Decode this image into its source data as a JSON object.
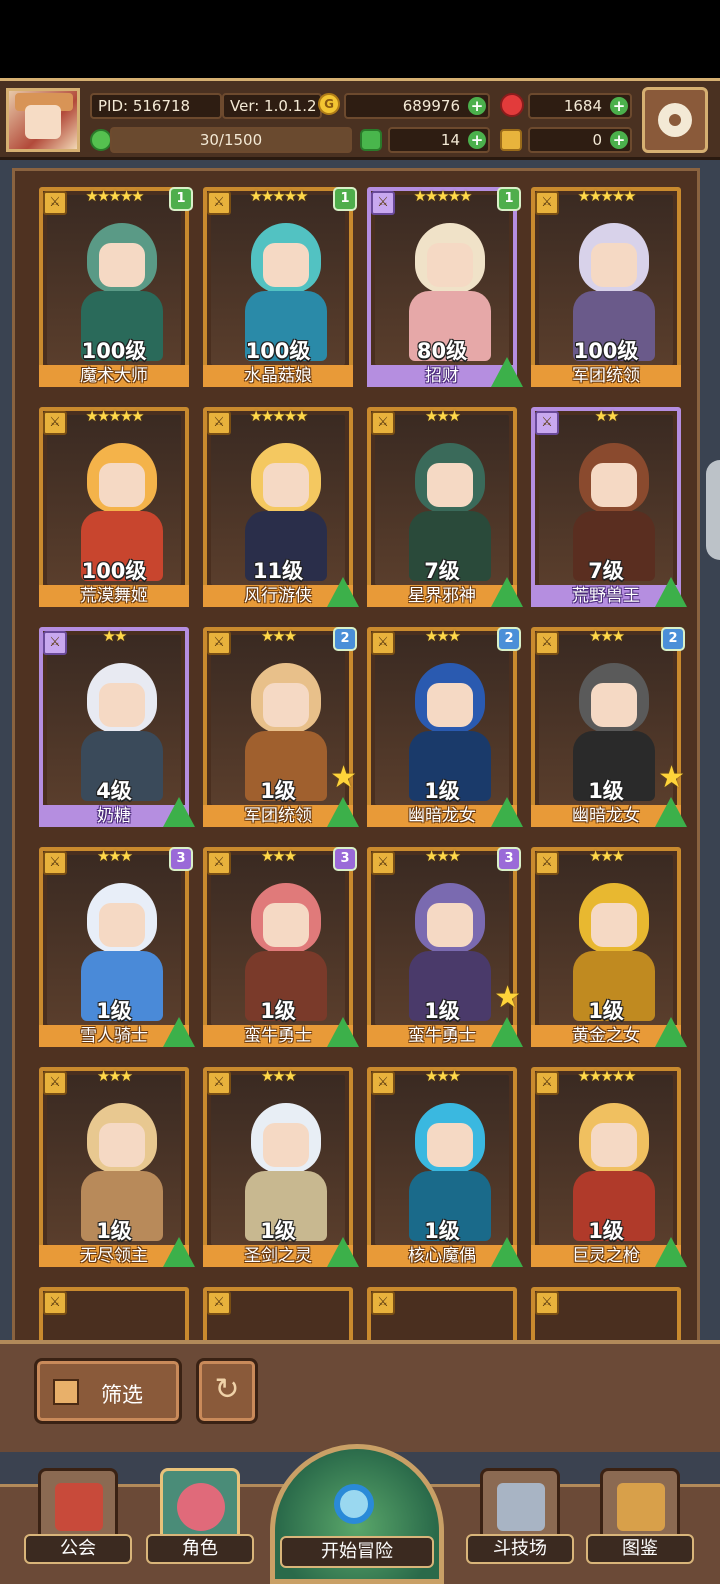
{
  "header": {
    "pid": "PID: 516718",
    "version": "Ver: 1.0.1.2",
    "gold": "689976",
    "gems": "1684",
    "energy": "30/1500",
    "clovers": "14",
    "keys": "0"
  },
  "cards": [
    {
      "name": "魔术大师",
      "level": "100级",
      "stars": "★★★★★",
      "badge": "1",
      "rarity": "gold"
    },
    {
      "name": "水晶菇娘",
      "level": "100级",
      "stars": "★★★★★",
      "badge": "1",
      "rarity": "gold"
    },
    {
      "name": "招财",
      "level": "80级",
      "stars": "★★★★★",
      "badge": "1",
      "rarity": "purple"
    },
    {
      "name": "军团统领",
      "level": "100级",
      "stars": "★★★★★",
      "badge": "",
      "rarity": "gold"
    },
    {
      "name": "荒漠舞姬",
      "level": "100级",
      "stars": "★★★★★",
      "badge": "",
      "rarity": "gold"
    },
    {
      "name": "风行游侠",
      "level": "11级",
      "stars": "★★★★★",
      "badge": "",
      "rarity": "gold"
    },
    {
      "name": "星界邪神",
      "level": "7级",
      "stars": "★★★",
      "badge": "",
      "rarity": "gold"
    },
    {
      "name": "荒野兽王",
      "level": "7级",
      "stars": "★★",
      "badge": "",
      "rarity": "purple"
    },
    {
      "name": "奶糖",
      "level": "4级",
      "stars": "★★",
      "badge": "",
      "rarity": "purple"
    },
    {
      "name": "军团统领",
      "level": "1级",
      "stars": "★★★",
      "badge": "2",
      "rarity": "gold"
    },
    {
      "name": "幽暗龙女",
      "level": "1级",
      "stars": "★★★",
      "badge": "2",
      "rarity": "gold"
    },
    {
      "name": "幽暗龙女",
      "level": "1级",
      "stars": "★★★",
      "badge": "2",
      "rarity": "gold"
    },
    {
      "name": "雪人骑士",
      "level": "1级",
      "stars": "★★★",
      "badge": "3",
      "rarity": "gold"
    },
    {
      "name": "蛮牛勇士",
      "level": "1级",
      "stars": "★★★",
      "badge": "3",
      "rarity": "gold"
    },
    {
      "name": "蛮牛勇士",
      "level": "1级",
      "stars": "★★★",
      "badge": "3",
      "rarity": "gold"
    },
    {
      "name": "黄金之女",
      "level": "1级",
      "stars": "★★★",
      "badge": "",
      "rarity": "gold"
    },
    {
      "name": "无尽领主",
      "level": "1级",
      "stars": "★★★",
      "badge": "",
      "rarity": "gold"
    },
    {
      "name": "圣剑之灵",
      "level": "1级",
      "stars": "★★★",
      "badge": "",
      "rarity": "gold"
    },
    {
      "name": "核心魔偶",
      "level": "1级",
      "stars": "★★★",
      "badge": "",
      "rarity": "gold"
    },
    {
      "name": "巨灵之枪",
      "level": "1级",
      "stars": "★★★★★",
      "badge": "",
      "rarity": "gold"
    }
  ],
  "controls": {
    "filter_label": "筛选"
  },
  "nav": {
    "guild": "公会",
    "role": "角色",
    "adventure": "开始冒险",
    "arena": "斗技场",
    "codex": "图鉴"
  },
  "colors": {
    "card_border_gold": "#c98a2e",
    "card_border_purple": "#b58ee0",
    "upgrade_arrow": "#3cb04a",
    "name_plate_gold": "#e89a38"
  }
}
